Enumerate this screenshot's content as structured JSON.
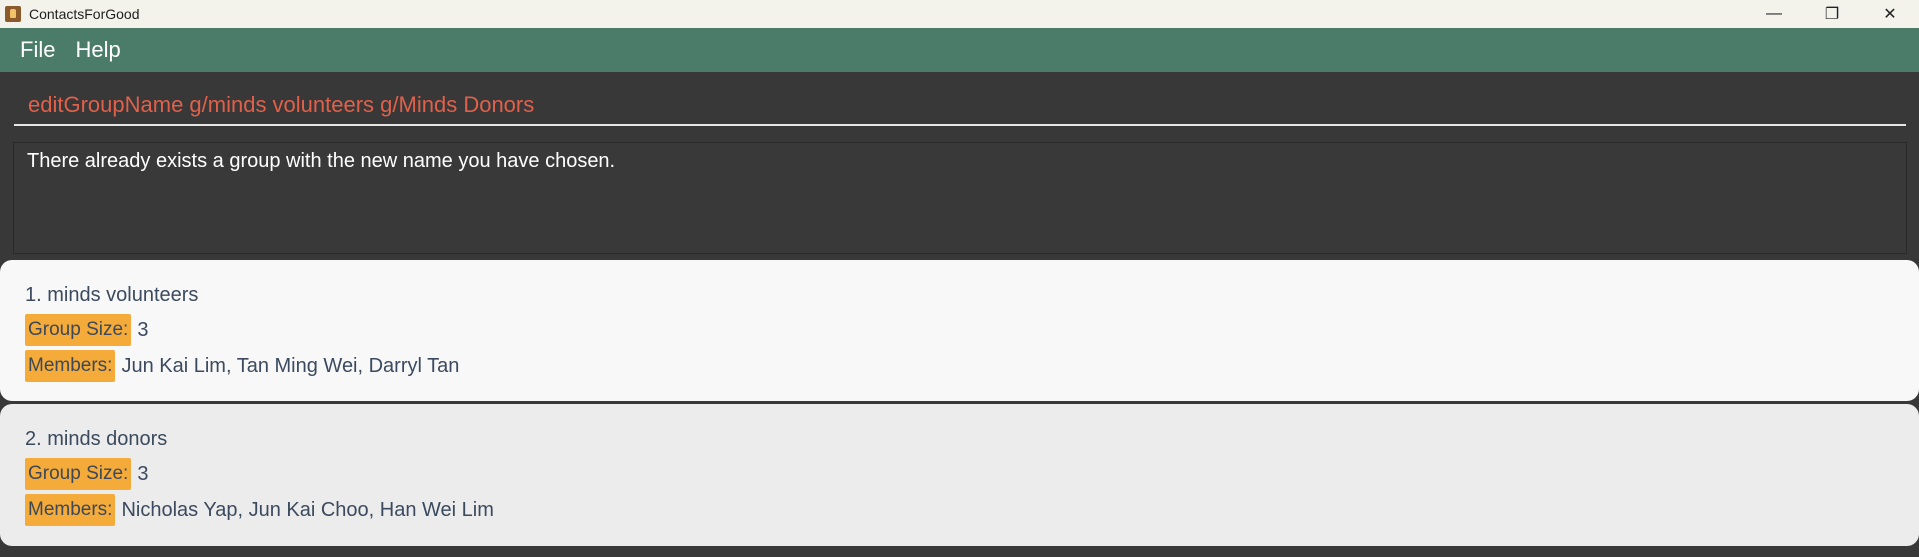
{
  "window": {
    "title": "ContactsForGood",
    "minimize": "—",
    "restore": "❐",
    "close": "✕"
  },
  "menu": {
    "file": "File",
    "help": "Help"
  },
  "command": {
    "value": "editGroupName g/minds volunteers g/Minds Donors"
  },
  "result": {
    "message": "There already exists a group with the new name you have chosen."
  },
  "groups": [
    {
      "title": "1. minds volunteers",
      "size_label": "Group Size:",
      "size": "3",
      "members_label": "Members:",
      "members": "Jun Kai Lim, Tan Ming Wei, Darryl Tan"
    },
    {
      "title": "2. minds donors",
      "size_label": "Group Size:",
      "size": "3",
      "members_label": "Members:",
      "members": "Nicholas Yap, Jun Kai Choo, Han Wei Lim"
    }
  ],
  "colors": {
    "menubar": "#4a7c69",
    "command_text": "#e0604a",
    "tag": "#f4ab3a",
    "background": "#383838"
  }
}
